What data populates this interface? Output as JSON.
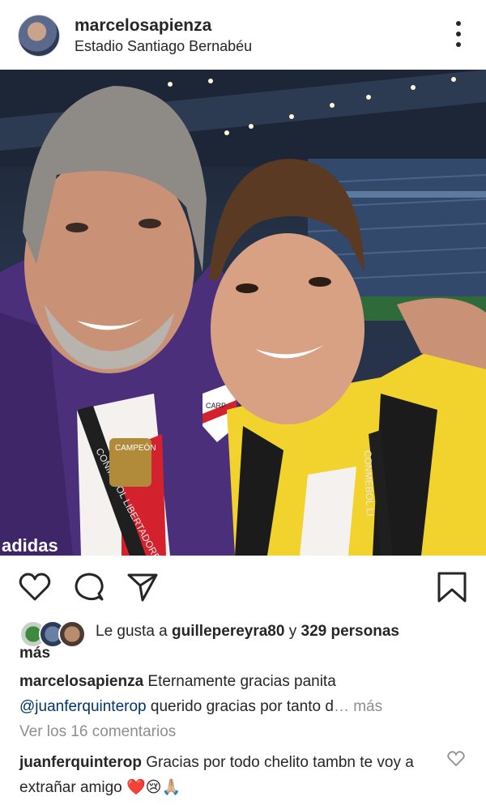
{
  "post": {
    "username": "marcelosapienza",
    "location": "Estadio Santiago Bernabéu"
  },
  "photo": {
    "jersey_text_left": "CONMEBOL LIBERTADORES",
    "jersey_text_right": "CONMEBOL LI",
    "badge_text": "CAMPEÓN",
    "brand_text": "adidas",
    "crest_text": "CARP"
  },
  "actions": {
    "like_icon": "heart-icon",
    "comment_icon": "comment-icon",
    "share_icon": "send-icon",
    "save_icon": "bookmark-icon"
  },
  "likes": {
    "prefix": "Le gusta a ",
    "user": "guillepereyra80",
    "connector": " y ",
    "count": "329 personas",
    "suffix": "más"
  },
  "caption": {
    "author": "marcelosapienza",
    "text_line1": " Eternamente gracias panita",
    "mention": "@juanferquinterop",
    "text_line2": " querido gracias por tanto d",
    "ellipsis": "…",
    "more": " más"
  },
  "view_comments": "Ver los 16 comentarios",
  "comment": {
    "author": "juanferquinterop",
    "text": " Gracias por todo chelito tambn te voy a extrañar amigo ❤️😢🙏🏼"
  },
  "colors": {
    "text": "#262626",
    "muted": "#8e8e8e",
    "mention": "#003569"
  }
}
